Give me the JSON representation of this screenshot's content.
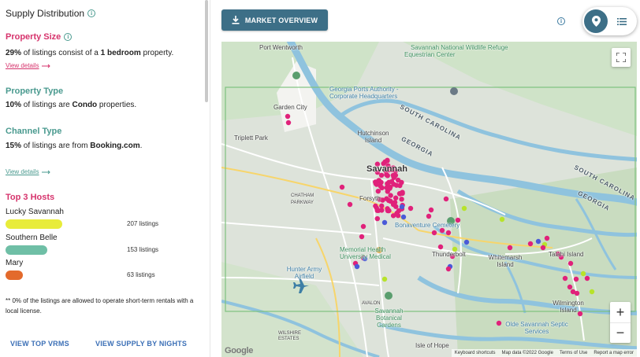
{
  "panel": {
    "title": "Supply Distribution",
    "property_size": {
      "heading": "Property Size",
      "pct": "29%",
      "text_a": " of listings consist of a ",
      "emph": "1 bedroom",
      "text_b": " property.",
      "link": "View details"
    },
    "property_type": {
      "heading": "Property Type",
      "pct": "10%",
      "text_a": " of listings are ",
      "emph": "Condo",
      "text_b": " properties."
    },
    "channel_type": {
      "heading": "Channel Type",
      "pct": "15%",
      "text_a": " of listings are from ",
      "emph": "Booking.com",
      "text_b": ".",
      "link": "View details"
    },
    "top_hosts": {
      "heading": "Top 3 Hosts",
      "hosts": [
        {
          "name": "Lucky Savannah",
          "count": "207 listings",
          "color": "#e8ec3a",
          "share": 1.0
        },
        {
          "name": "Southern Belle",
          "count": "153 listings",
          "color": "#6fbfa6",
          "share": 0.74
        },
        {
          "name": "Mary",
          "count": "63 listings",
          "color": "#e36a2c",
          "share": 0.3
        }
      ]
    },
    "note": "** 0% of the listings are allowed to operate short-term rentals with a local license.",
    "buttons": {
      "top_vrms": "VIEW TOP VRMS",
      "supply_by_nights": "VIEW SUPPLY BY NIGHTS"
    }
  },
  "toolbar": {
    "market_overview": "MARKET OVERVIEW",
    "map_view_icon": "location-pin-icon",
    "list_view_icon": "list-icon"
  },
  "map": {
    "labels": {
      "port_wentworth": "Port Wentworth",
      "savannah_wildlife": "Savannah National Wildlife Refuge",
      "equestrian": "Equestrian Center",
      "ga_ports": "Georgia Ports Authority - Corporate Headquarters",
      "garden_city": "Garden City",
      "south_carolina": "SOUTH CAROLINA",
      "georgia": "GEORGIA",
      "hutchinson": "Hutchinson Island",
      "triplett": "Triplett Park",
      "savannah": "Savannah",
      "chatham": "CHATHAM PARKWAY",
      "forsyth": "Forsyth",
      "bonaventure": "Bonaventure Cemetery",
      "memorial": "Memorial Health University Medical",
      "thunderbolt": "Thunderbolt",
      "whitemarsh": "Whitemarsh Island",
      "talahi": "Talahi Island",
      "hunter": "Hunter Army Airfield",
      "avalon": "AVALON",
      "savannah_gardens": "Savannah Botanical Gardens",
      "wilmington": "Wilmington Island",
      "oldesavannah": "Olde Savannah Septic Services",
      "isle_of_hope": "Isle of Hope",
      "wilshire": "WILSHIRE ESTATES",
      "sc2": "SOUTH CAROLINA",
      "ga2": "GEORGIA"
    },
    "attribution": {
      "keyboard": "Keyboard shortcuts",
      "data": "Map data ©2022 Google",
      "terms": "Terms of Use",
      "report": "Report a map error"
    },
    "logo": "Google",
    "zoom_in": "+",
    "zoom_out": "−",
    "marker_colors": {
      "pink": "#e0217a",
      "blue": "#4a5ad8",
      "green": "#b7e32a"
    }
  }
}
